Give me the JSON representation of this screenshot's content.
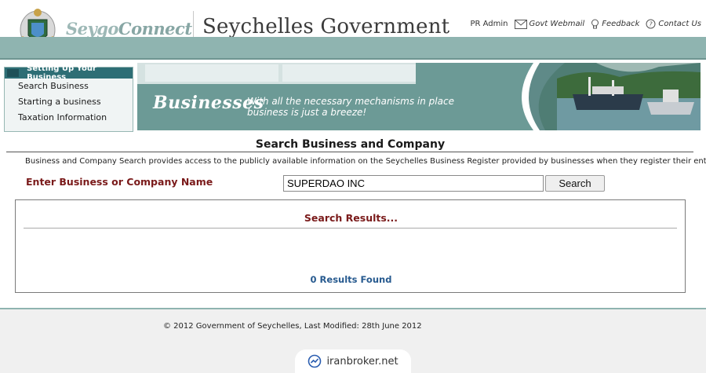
{
  "header": {
    "brand": {
      "part1": "Seygo",
      "part2": "Connect"
    },
    "title": "Seychelles Government",
    "links": {
      "pr_admin": "PR Admin",
      "webmail": "Govt Webmail",
      "feedback": "Feedback",
      "contact": "Contact Us"
    },
    "icons": [
      "coat-of-arms",
      "mail-icon",
      "lightbulb-icon",
      "help-icon"
    ]
  },
  "sidebar": {
    "heading": "Setting Up Your Business",
    "items": [
      {
        "label": "Search Business"
      },
      {
        "label": "Starting a business"
      },
      {
        "label": "Taxation Information"
      }
    ]
  },
  "banner": {
    "word": "Businesses",
    "tagline": "With all the necessary mechanisms in place business is just a breeze!"
  },
  "main": {
    "heading": "Search Business and Company",
    "description": "Business and Company Search provides access to the publicly available information on the Seychelles Business Register provided by businesses when they register their entity.",
    "search_label": "Enter Business or Company Name",
    "search_value": "SUPERDAO INC",
    "search_button": "Search",
    "results_title": "Search Results...",
    "results_count": "0 Results Found"
  },
  "footer": {
    "text": "© 2012 Government of Seychelles, Last Modified: 28th June 2012"
  },
  "watermark": {
    "text": "iranbroker.net"
  },
  "colors": {
    "teal": "#8fb4b0",
    "dark_teal": "#2e6e75",
    "label_red": "#7a1a1a",
    "results_blue": "#275a8f"
  }
}
